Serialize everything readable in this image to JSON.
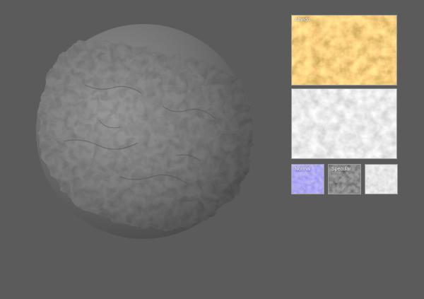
{
  "scene": {
    "background": "#5b5b5b",
    "preview_sphere": "material-preview-sphere"
  },
  "texture_maps": {
    "albedo": {
      "label": "Albedo",
      "color": "#c08a45"
    },
    "height": {
      "label": "",
      "color": "#d6d6d6"
    },
    "normal": {
      "label": "Normal",
      "color": "#5a5ad8"
    },
    "specular": {
      "label": "Specular",
      "color": "#2e2e2e"
    },
    "roughness": {
      "label": "",
      "color": "#cfcfcf"
    }
  }
}
